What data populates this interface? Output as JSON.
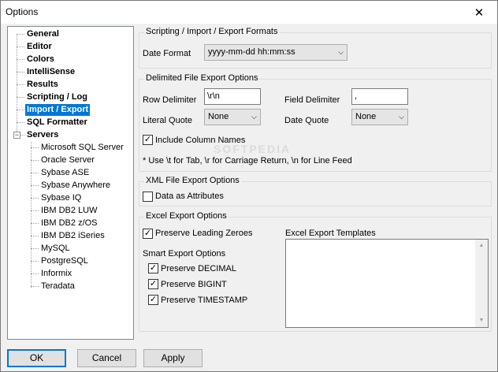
{
  "window": {
    "title": "Options"
  },
  "tree": {
    "items": [
      {
        "label": "General"
      },
      {
        "label": "Editor"
      },
      {
        "label": "Colors"
      },
      {
        "label": "IntelliSense"
      },
      {
        "label": "Results"
      },
      {
        "label": "Scripting / Log"
      },
      {
        "label": "Import / Export"
      },
      {
        "label": "SQL Formatter"
      },
      {
        "label": "Servers"
      }
    ],
    "servers": [
      {
        "label": "Microsoft SQL Server"
      },
      {
        "label": "Oracle Server"
      },
      {
        "label": "Sybase ASE"
      },
      {
        "label": "Sybase Anywhere"
      },
      {
        "label": "Sybase IQ"
      },
      {
        "label": "IBM DB2 LUW"
      },
      {
        "label": "IBM DB2 z/OS"
      },
      {
        "label": "IBM DB2 iSeries"
      },
      {
        "label": "MySQL"
      },
      {
        "label": "PostgreSQL"
      },
      {
        "label": "Informix"
      },
      {
        "label": "Teradata"
      }
    ],
    "selected": "Import / Export"
  },
  "scripting": {
    "group_label": "Scripting / Import / Export Formats",
    "date_format_label": "Date Format",
    "date_format_value": "yyyy-mm-dd hh:mm:ss"
  },
  "delimited": {
    "group_label": "Delimited File Export Options",
    "row_delimiter_label": "Row Delimiter",
    "row_delimiter_value": "\\r\\n",
    "field_delimiter_label": "Field Delimiter",
    "field_delimiter_value": ",",
    "literal_quote_label": "Literal Quote",
    "literal_quote_value": "None",
    "date_quote_label": "Date Quote",
    "date_quote_value": "None",
    "include_columns_label": "Include Column Names",
    "include_columns_checked": true,
    "hint": "* Use \\t for Tab, \\r for Carriage Return, \\n for Line Feed"
  },
  "xml": {
    "group_label": "XML File Export Options",
    "data_as_attributes_label": "Data as Attributes",
    "data_as_attributes_checked": false
  },
  "excel": {
    "group_label": "Excel Export Options",
    "preserve_leading_label": "Preserve Leading Zeroes",
    "preserve_leading_checked": true,
    "templates_label": "Excel Export Templates",
    "smart_label": "Smart Export Options",
    "preserve_decimal_label": "Preserve DECIMAL",
    "preserve_bigint_label": "Preserve BIGINT",
    "preserve_timestamp_label": "Preserve TIMESTAMP"
  },
  "buttons": {
    "ok": "OK",
    "cancel": "Cancel",
    "apply": "Apply"
  },
  "watermark": "SOFTPEDIA"
}
